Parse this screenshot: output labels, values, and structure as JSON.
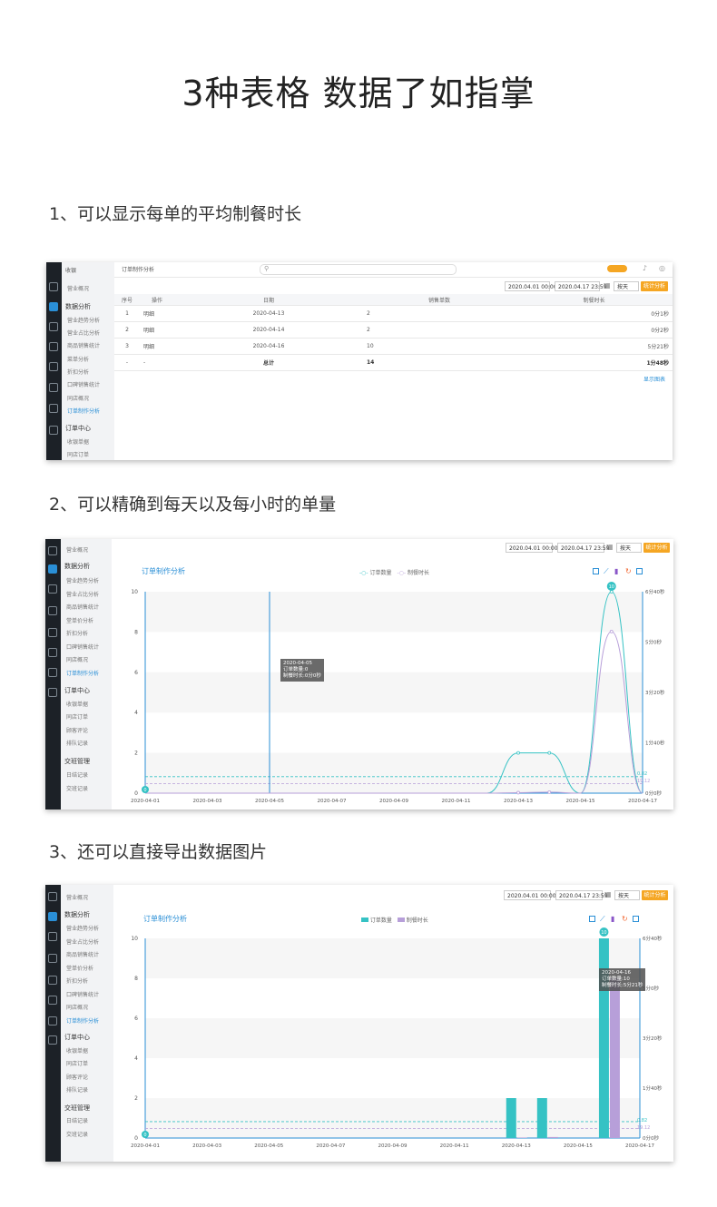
{
  "title": "3种表格 数据了如指掌",
  "steps": [
    "1、可以显示每单的平均制餐时长",
    "2、可以精确到每天以及每小时的单量",
    "3、还可以直接导出数据图片"
  ],
  "shot1": {
    "app_label": "收银",
    "page_tab": "订单制作分析",
    "search_placeholder": "",
    "badge": "",
    "sidebar": {
      "top": "营业概况",
      "group1": "数据分析",
      "items": [
        "营业趋势分析",
        "营业占比分析",
        "商品销售统计",
        "菜单分析",
        "折扣分析",
        "口碑销售统计",
        "同店概况",
        "订单制作分析"
      ],
      "group2": "订单中心",
      "items2": [
        "收银单据",
        "同店订单"
      ]
    },
    "filter": {
      "start": "2020.04.01 00:00",
      "end": "2020.04.17 23:59",
      "period": "按天",
      "button": "统计分析"
    },
    "columns": [
      "序号",
      "操作",
      "日期",
      "销售单数",
      "制餐时长"
    ],
    "rows": [
      [
        "1",
        "明细",
        "2020-04-13",
        "2",
        "0分1秒"
      ],
      [
        "2",
        "明细",
        "2020-04-14",
        "2",
        "0分2秒"
      ],
      [
        "3",
        "明细",
        "2020-04-16",
        "10",
        "5分21秒"
      ],
      [
        "-",
        "-",
        "总计",
        "14",
        "1分48秒"
      ]
    ],
    "footer_link": "显示图表"
  },
  "shot2": {
    "sidebar": {
      "top": "营业概况",
      "group1": "数据分析",
      "items": [
        "营业趋势分析",
        "营业占比分析",
        "商品销售统计",
        "堂单价分析",
        "折扣分析",
        "口碑销售统计",
        "同店概况",
        "订单制作分析"
      ],
      "group2": "订单中心",
      "items2": [
        "收银单据",
        "同店订单",
        "顾客评论",
        "排队记录"
      ],
      "group3": "交班管理",
      "items3": [
        "日结记录",
        "交班记录"
      ]
    },
    "filter": {
      "start": "2020.04.01 00:00",
      "end": "2020.04.17 23:59",
      "period": "按天",
      "button": "统计分析"
    },
    "chart_title": "订单制作分析",
    "legend": [
      "订单数量",
      "制餐时长"
    ],
    "tooltip": [
      "2020-04-05",
      "订单数量:0",
      "制餐时长:0分0秒"
    ],
    "avg_labels": [
      "0.82",
      "19.12"
    ]
  },
  "shot3": {
    "sidebar": {
      "top": "营业概况",
      "group1": "数据分析",
      "items": [
        "营业趋势分析",
        "营业占比分析",
        "商品销售统计",
        "堂单价分析",
        "折扣分析",
        "口碑销售统计",
        "同店概况",
        "订单制作分析"
      ],
      "group2": "订单中心",
      "items2": [
        "收银单据",
        "同店订单",
        "顾客评论",
        "排队记录"
      ],
      "group3": "交班管理",
      "items3": [
        "日结记录",
        "交班记录"
      ]
    },
    "filter": {
      "start": "2020.04.01 00:00",
      "end": "2020.04.17 23:59",
      "period": "按天",
      "button": "统计分析"
    },
    "chart_title": "订单制作分析",
    "legend": [
      "订单数量",
      "制餐时长"
    ],
    "tooltip": [
      "2020-04-16",
      "订单数量:10",
      "制餐时长:5分21秒"
    ],
    "avg_labels": [
      "0.82",
      "19.12"
    ]
  },
  "chart_data": [
    {
      "type": "line",
      "title": "订单制作分析",
      "x": [
        "2020-04-01",
        "2020-04-02",
        "2020-04-03",
        "2020-04-04",
        "2020-04-05",
        "2020-04-06",
        "2020-04-07",
        "2020-04-08",
        "2020-04-09",
        "2020-04-10",
        "2020-04-11",
        "2020-04-12",
        "2020-04-13",
        "2020-04-14",
        "2020-04-15",
        "2020-04-16",
        "2020-04-17"
      ],
      "x_tick_labels": [
        "2020-04-01",
        "2020-04-03",
        "2020-04-05",
        "2020-04-07",
        "2020-04-09",
        "2020-04-11",
        "2020-04-13",
        "2020-04-15",
        "2020-04-17"
      ],
      "series": [
        {
          "name": "订单数量",
          "axis": "left",
          "values": [
            0,
            0,
            0,
            0,
            0,
            0,
            0,
            0,
            0,
            0,
            0,
            0,
            2,
            2,
            0,
            10,
            0
          ]
        },
        {
          "name": "制餐时长",
          "axis": "right",
          "unit": "seconds",
          "values": [
            0,
            0,
            0,
            0,
            0,
            0,
            0,
            0,
            0,
            0,
            0,
            0,
            1,
            2,
            0,
            321,
            0
          ]
        }
      ],
      "ylim_left": [
        0,
        10
      ],
      "y_ticks_left": [
        0,
        2,
        4,
        6,
        8,
        10
      ],
      "y_ticks_right": [
        "0分0秒",
        "1分40秒",
        "3分20秒",
        "5分0秒",
        "6分40秒"
      ],
      "ylim_right_seconds": [
        0,
        400
      ],
      "grid": true
    },
    {
      "type": "bar",
      "title": "订单制作分析",
      "x": [
        "2020-04-01",
        "2020-04-02",
        "2020-04-03",
        "2020-04-04",
        "2020-04-05",
        "2020-04-06",
        "2020-04-07",
        "2020-04-08",
        "2020-04-09",
        "2020-04-10",
        "2020-04-11",
        "2020-04-12",
        "2020-04-13",
        "2020-04-14",
        "2020-04-15",
        "2020-04-16",
        "2020-04-17"
      ],
      "x_tick_labels": [
        "2020-04-01",
        "2020-04-03",
        "2020-04-05",
        "2020-04-07",
        "2020-04-09",
        "2020-04-11",
        "2020-04-13",
        "2020-04-15",
        "2020-04-17"
      ],
      "series": [
        {
          "name": "订单数量",
          "axis": "left",
          "values": [
            0,
            0,
            0,
            0,
            0,
            0,
            0,
            0,
            0,
            0,
            0,
            0,
            2,
            2,
            0,
            10,
            0
          ]
        },
        {
          "name": "制餐时长",
          "axis": "right",
          "unit": "seconds",
          "values": [
            0,
            0,
            0,
            0,
            0,
            0,
            0,
            0,
            0,
            0,
            0,
            0,
            1,
            2,
            0,
            321,
            0
          ]
        }
      ],
      "ylim_left": [
        0,
        10
      ],
      "y_ticks_left": [
        0,
        2,
        4,
        6,
        8,
        10
      ],
      "y_ticks_right": [
        "0分0秒",
        "1分40秒",
        "3分20秒",
        "5分0秒",
        "6分40秒"
      ],
      "ylim_right_seconds": [
        0,
        400
      ],
      "grid": true
    }
  ],
  "colors": {
    "accent": "#2a8fd6",
    "teal": "#35c2c4",
    "purple": "#b79fd9",
    "orange": "#f5a623",
    "dark": "#1c2127"
  }
}
